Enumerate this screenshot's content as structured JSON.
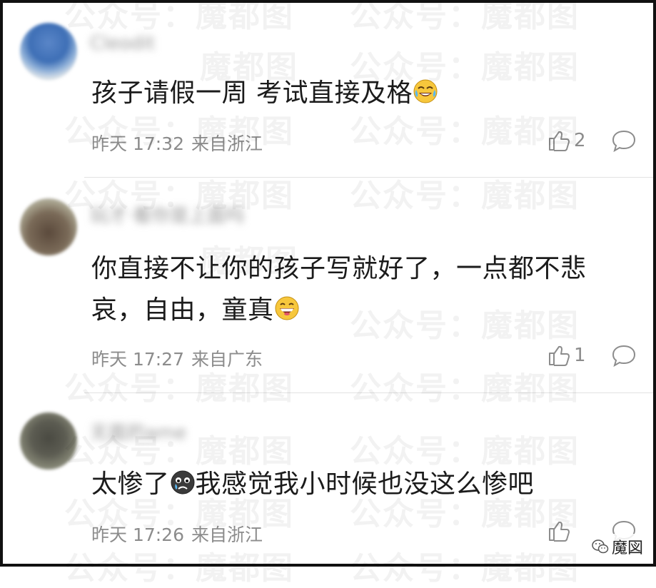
{
  "comments": [
    {
      "username": "Cleodit",
      "text": "孩子请假一周 考试直接及格",
      "emoji": "laugh-cry-emoji",
      "time": "昨天 17:32",
      "location": "来自浙江",
      "likes": "2"
    },
    {
      "username": "玩才·看你是上面吗",
      "text_line1": "你直接不让你的孩子写就好了，一点都不悲",
      "text_line2": "哀，自由，童真",
      "emoji": "grin-emoji",
      "time": "昨天 17:27",
      "location": "来自广东",
      "likes": "1"
    },
    {
      "username": "无面的ame",
      "text_before": "太惨了",
      "emoji": "sad-face-emoji",
      "text_after": "我感觉我小时候也没这么惨吧",
      "time": "昨天 17:26",
      "location": "来自浙江"
    }
  ],
  "watermark": "公众号：魔都图",
  "corner_logo": {
    "text": "魔図"
  },
  "colors": {
    "text": "#1b1b1b",
    "meta": "#8c8c8c",
    "divider": "#e3e3e3",
    "frame": "#111111"
  }
}
